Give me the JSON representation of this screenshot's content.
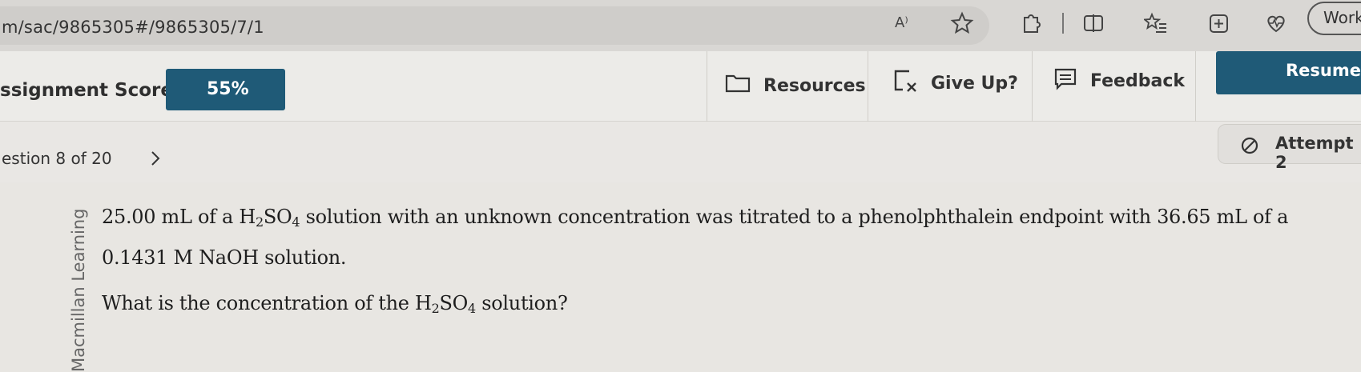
{
  "browser": {
    "url": "m/sac/9865305#/9865305/7/1",
    "read_aloud": "A⁾",
    "work_label": "Work"
  },
  "header": {
    "score_label": "ssignment Score:",
    "score_value": "55%",
    "resources": "Resources",
    "give_up": "Give Up?",
    "feedback": "Feedback",
    "resume": "Resume"
  },
  "question_nav": {
    "position": "estion 8 of 20",
    "attempt": "Attempt 2"
  },
  "content": {
    "side_label": "Macmillan Learning",
    "line1_a": "25.00 mL of a H",
    "line1_sub1": "2",
    "line1_b": "SO",
    "line1_sub2": "4",
    "line1_c": " solution with an unknown concentration was titrated to a phenolphthalein endpoint with 36.65 mL of a",
    "line2": "0.1431 M NaOH solution.",
    "line3_a": "What is the concentration of the H",
    "line3_sub1": "2",
    "line3_b": "SO",
    "line3_sub2": "4",
    "line3_c": " solution?"
  },
  "colors": {
    "accent": "#1f5a77",
    "background": "#e9e7e4"
  },
  "icons": [
    "read-aloud-icon",
    "favorite-star-icon",
    "extensions-icon",
    "split-screen-icon",
    "favorites-list-icon",
    "add-collection-icon",
    "heart-pulse-icon",
    "resources-folder-icon",
    "give-up-icon",
    "feedback-icon",
    "chevron-right-icon",
    "no-entry-icon"
  ]
}
